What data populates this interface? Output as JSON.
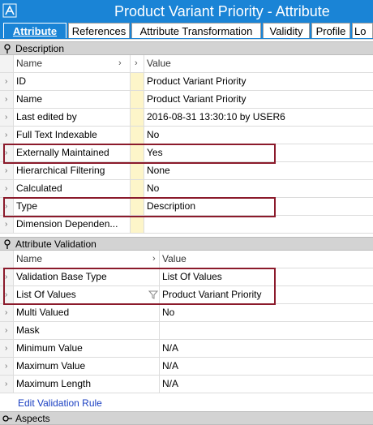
{
  "window": {
    "title": "Product Variant Priority - Attribute"
  },
  "tabs": [
    {
      "label": "Attribute",
      "active": true
    },
    {
      "label": "References"
    },
    {
      "label": "Attribute Transformation"
    },
    {
      "label": "Validity"
    },
    {
      "label": "Profile"
    },
    {
      "label": "Lo"
    }
  ],
  "description": {
    "header": "Description",
    "columns": {
      "name": "Name",
      "value": "Value"
    },
    "rows": [
      {
        "name": "ID",
        "value": "Product Variant Priority"
      },
      {
        "name": "Name",
        "value": "Product Variant Priority"
      },
      {
        "name": "Last edited by",
        "value": "2016-08-31 13:30:10 by USER6"
      },
      {
        "name": "Full Text Indexable",
        "value": "No"
      },
      {
        "name": "Externally Maintained",
        "value": "Yes"
      },
      {
        "name": "Hierarchical Filtering",
        "value": "None"
      },
      {
        "name": "Calculated",
        "value": "No"
      },
      {
        "name": "Type",
        "value": "Description"
      },
      {
        "name": "Dimension Dependen...",
        "value": ""
      }
    ]
  },
  "validation": {
    "header": "Attribute Validation",
    "columns": {
      "name": "Name",
      "value": "Value"
    },
    "rows": [
      {
        "name": "Validation Base Type",
        "value": "List Of Values"
      },
      {
        "name": "List Of Values",
        "value": "Product Variant Priority"
      },
      {
        "name": "Multi Valued",
        "value": "No"
      },
      {
        "name": "Mask",
        "value": ""
      },
      {
        "name": "Minimum Value",
        "value": "N/A"
      },
      {
        "name": "Maximum Value",
        "value": "N/A"
      },
      {
        "name": "Maximum Length",
        "value": "N/A"
      }
    ],
    "edit_link": "Edit Validation Rule"
  },
  "aspects": {
    "header": "Aspects"
  },
  "colors": {
    "title_bar": "#1a84d6",
    "highlight": "#8b1a2b",
    "link": "#1a3fc2",
    "gap_column": "#fdf5c9"
  }
}
